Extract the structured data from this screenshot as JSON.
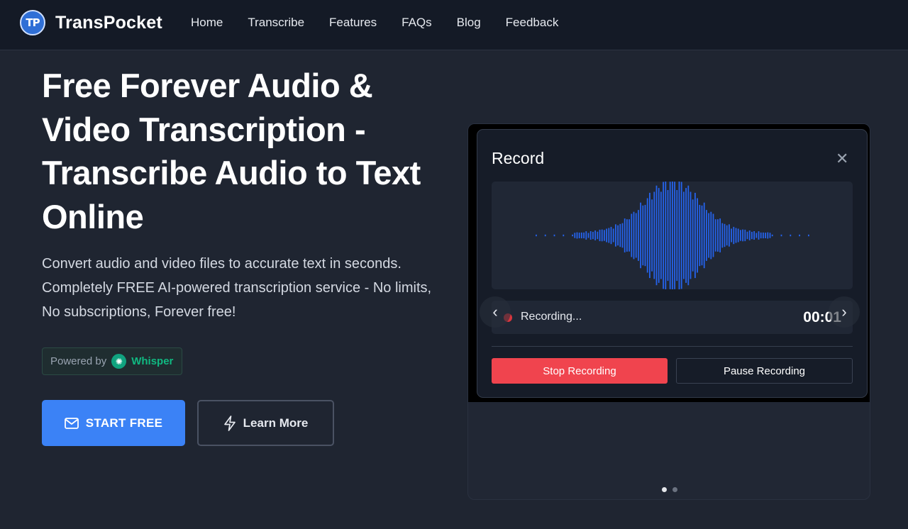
{
  "brand": {
    "logo_mark": "TP",
    "name": "TransPocket"
  },
  "nav": {
    "items": [
      {
        "label": "Home"
      },
      {
        "label": "Transcribe"
      },
      {
        "label": "Features"
      },
      {
        "label": "FAQs"
      },
      {
        "label": "Blog"
      },
      {
        "label": "Feedback"
      }
    ]
  },
  "hero": {
    "title": "Free Forever Audio & Video Transcription - Transcribe Audio to Text Online",
    "subtitle": "Convert audio and video files to accurate text in seconds. Completely FREE AI-powered transcription service - No limits, No subscriptions, Forever free!",
    "powered_by": {
      "prefix": "Powered by",
      "name": "Whisper",
      "icon": "openai-icon"
    },
    "cta_primary": {
      "label": "START FREE",
      "icon": "mail-icon"
    },
    "cta_secondary": {
      "label": "Learn More",
      "icon": "lightning-icon"
    }
  },
  "record_modal": {
    "title": "Record",
    "close_icon": "close-icon",
    "status_text": "Recording...",
    "timer": "00:01",
    "stop_label": "Stop Recording",
    "pause_label": "Pause Recording"
  },
  "carousel": {
    "prev_icon": "chevron-left-icon",
    "next_icon": "chevron-right-icon",
    "slide_count": 2,
    "active_index": 0
  },
  "colors": {
    "background": "#1f2531",
    "nav_background": "#141a26",
    "accent_blue": "#3b82f6",
    "stop_red": "#f0444e",
    "whisper_green": "#10b981",
    "waveform_blue": "#2563eb"
  }
}
